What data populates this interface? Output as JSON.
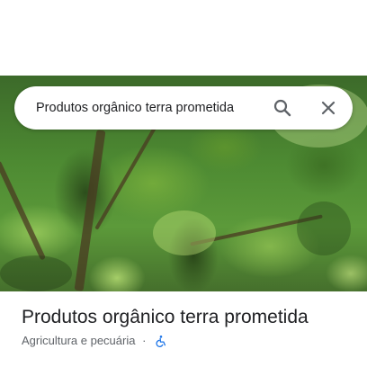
{
  "search": {
    "query": "Produtos orgânico terra prometida",
    "search_icon": "search-icon",
    "close_icon": "close-icon"
  },
  "hero": {
    "image_icon": "place-photo"
  },
  "place": {
    "name": "Produtos orgânico terra prometida",
    "category": "Agricultura e pecuária",
    "separator": "·",
    "accessibility_icon": "wheelchair-accessible-icon"
  },
  "colors": {
    "text_primary": "#202124",
    "text_secondary": "#5f6368",
    "icon_grey": "#5f6368",
    "accessibility_blue": "#1a73e8"
  }
}
